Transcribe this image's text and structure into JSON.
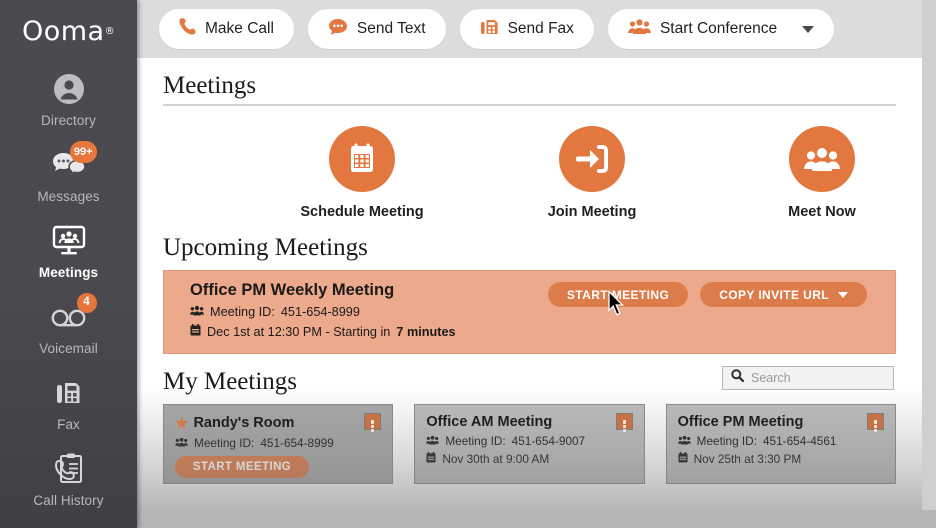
{
  "brand": {
    "name": "Ooma",
    "registered": "®"
  },
  "sidebar": {
    "items": [
      {
        "label": "Directory",
        "icon": "user-circle-icon",
        "badge": null,
        "active": false
      },
      {
        "label": "Messages",
        "icon": "chat-bubbles-icon",
        "badge": "99+",
        "active": false
      },
      {
        "label": "Meetings",
        "icon": "monitor-people-icon",
        "badge": null,
        "active": true
      },
      {
        "label": "Voicemail",
        "icon": "voicemail-icon",
        "badge": "4",
        "active": false
      },
      {
        "label": "Fax",
        "icon": "fax-icon",
        "badge": null,
        "active": false
      },
      {
        "label": "Call History",
        "icon": "call-history-icon",
        "badge": null,
        "active": false
      }
    ]
  },
  "topbar": {
    "buttons": [
      {
        "label": "Make Call",
        "icon": "phone-icon",
        "caret": false
      },
      {
        "label": "Send Text",
        "icon": "chat-bubble-icon",
        "caret": false
      },
      {
        "label": "Send Fax",
        "icon": "fax-icon",
        "caret": false
      },
      {
        "label": "Start Conference",
        "icon": "people-icon",
        "caret": true
      }
    ]
  },
  "page": {
    "title": "Meetings",
    "actions": [
      {
        "label": "Schedule Meeting",
        "icon": "calendar-icon"
      },
      {
        "label": "Join Meeting",
        "icon": "arrow-into-door-icon"
      },
      {
        "label": "Meet Now",
        "icon": "people-icon"
      }
    ],
    "upcoming": {
      "section_title": "Upcoming Meetings",
      "name": "Office PM Weekly Meeting",
      "meeting_id_label": "Meeting ID:",
      "meeting_id": "451-654-8999",
      "schedule_prefix": "Dec 1st at 12:30 PM - Starting in",
      "schedule_highlight": "7 minutes",
      "start_button": "START MEETING",
      "copy_button": "COPY INVITE URL"
    },
    "my_meetings": {
      "section_title": "My Meetings",
      "search_placeholder": "Search",
      "search_value": "",
      "cards": [
        {
          "title": "Randy's Room",
          "favorite": true,
          "meeting_id_label": "Meeting ID:",
          "meeting_id": "451-654-8999",
          "date": null,
          "start_button": "START MEETING"
        },
        {
          "title": "Office AM Meeting",
          "favorite": false,
          "meeting_id_label": "Meeting ID:",
          "meeting_id": "451-654-9007",
          "date": "Nov 30th at 9:00 AM",
          "start_button": null
        },
        {
          "title": "Office PM Meeting",
          "favorite": false,
          "meeting_id_label": "Meeting ID:",
          "meeting_id": "451-654-4561",
          "date": "Nov 25th at 3:30 PM",
          "start_button": null
        }
      ]
    }
  },
  "colors": {
    "accent_orange": "#e2783f",
    "sidebar_dark": "#4b4b4f",
    "upcoming_card": "#eda98b",
    "button_orange": "#dd7c4b"
  }
}
